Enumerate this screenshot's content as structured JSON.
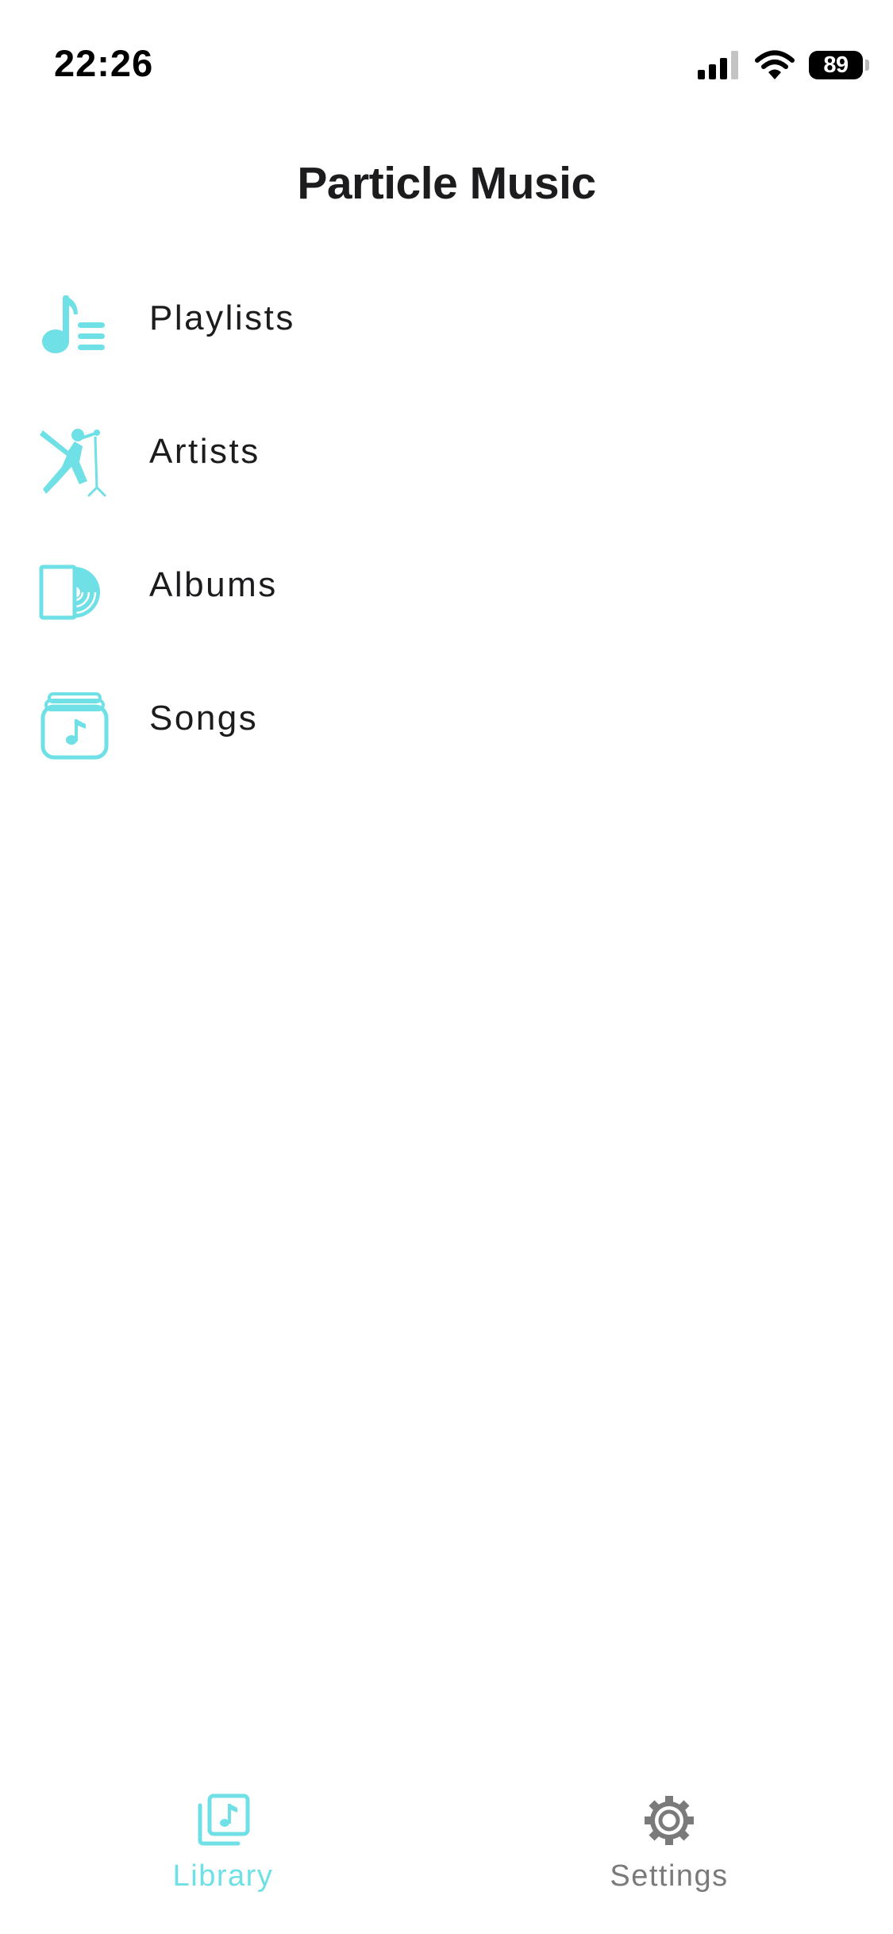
{
  "status_bar": {
    "time": "22:26",
    "battery_level": "89",
    "icons": [
      "signal-icon",
      "wifi-icon",
      "battery-icon"
    ]
  },
  "header": {
    "title": "Particle Music"
  },
  "library_menu": {
    "items": [
      {
        "label": "Playlists",
        "icon": "playlist-icon"
      },
      {
        "label": "Artists",
        "icon": "singer-icon"
      },
      {
        "label": "Albums",
        "icon": "album-icon"
      },
      {
        "label": "Songs",
        "icon": "songs-stack-icon"
      }
    ]
  },
  "tab_bar": {
    "tabs": [
      {
        "label": "Library",
        "icon": "music-library-icon",
        "active": true
      },
      {
        "label": "Settings",
        "icon": "gear-icon",
        "active": false
      }
    ]
  },
  "colors": {
    "accent": "#6fe0e6",
    "text": "#1c1c1e",
    "inactive": "#7a7a7a",
    "background": "#ffffff"
  }
}
